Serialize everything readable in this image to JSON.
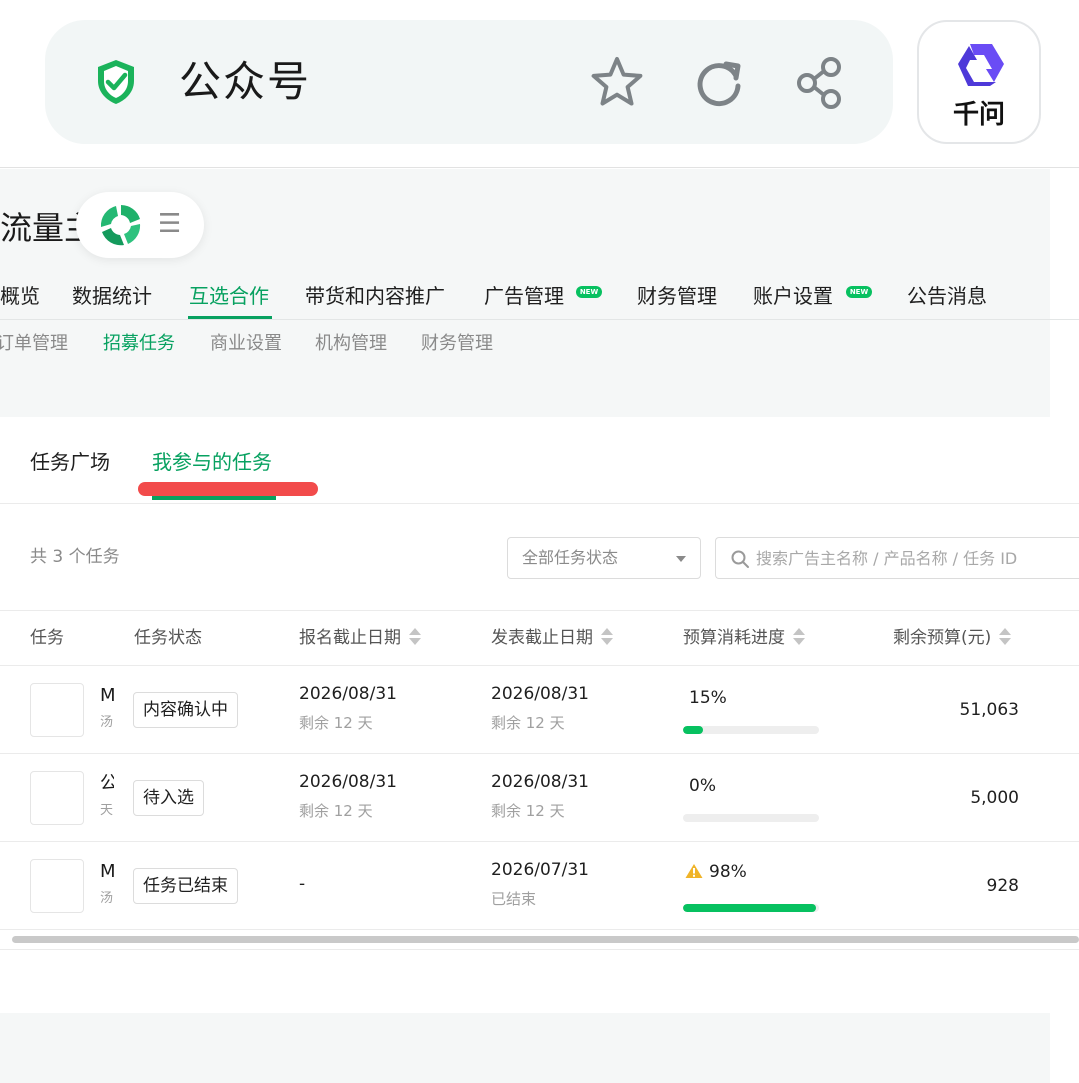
{
  "browser": {
    "site_title": "公众号",
    "icons": [
      "shield-check-icon",
      "star-icon",
      "reload-icon",
      "share-icon"
    ],
    "assistant": {
      "label": "千问",
      "icon": "qwen-logo-icon"
    }
  },
  "account": {
    "name": "流量主",
    "pill_icons": [
      "wechat-channels-logo-icon",
      "menu-icon"
    ]
  },
  "main_nav": {
    "items": [
      {
        "label": "概览"
      },
      {
        "label": "数据统计"
      },
      {
        "label": "互选合作",
        "active": true
      },
      {
        "label": "带货和内容推广"
      },
      {
        "label": "广告管理",
        "badge": "NEW"
      },
      {
        "label": "财务管理"
      },
      {
        "label": "账户设置",
        "badge": "NEW"
      },
      {
        "label": "公告消息"
      }
    ]
  },
  "sub_nav": {
    "items": [
      {
        "label": "订单管理"
      },
      {
        "label": "招募任务",
        "active": true
      },
      {
        "label": "商业设置"
      },
      {
        "label": "机构管理"
      },
      {
        "label": "财务管理"
      }
    ]
  },
  "tabs": [
    {
      "label": "任务广场"
    },
    {
      "label": "我参与的任务",
      "active": true
    }
  ],
  "toolbar": {
    "count_text": "共 3 个任务",
    "status_filter": "全部任务状态",
    "search_placeholder": "搜索广告主名称 / 产品名称 / 任务 ID"
  },
  "table": {
    "columns": [
      "任务",
      "任务状态",
      "报名截止日期",
      "发表截止日期",
      "预算消耗进度",
      "剩余预算(元)"
    ],
    "rows": [
      {
        "name": "M",
        "sub": "汤",
        "status": "内容确认中",
        "signup_deadline": "2026/08/31",
        "signup_remain": "剩余 12 天",
        "publish_deadline": "2026/08/31",
        "publish_remain": "剩余 12 天",
        "progress_text": "15%",
        "progress": 15,
        "warning": false,
        "budget": "51,063"
      },
      {
        "name": "公",
        "sub": "天",
        "status": "待入选",
        "signup_deadline": "2026/08/31",
        "signup_remain": "剩余 12 天",
        "publish_deadline": "2026/08/31",
        "publish_remain": "剩余 12 天",
        "progress_text": "0%",
        "progress": 0,
        "warning": false,
        "budget": "5,000"
      },
      {
        "name": "M",
        "sub": "汤",
        "status": "任务已结束",
        "signup_deadline": "-",
        "signup_remain": "",
        "publish_deadline": "2026/07/31",
        "publish_remain": "已结束",
        "progress_text": "98%",
        "progress": 98,
        "warning": true,
        "budget": "928"
      }
    ]
  },
  "colors": {
    "accent": "#07a160",
    "progress_fill": "#07c160",
    "highlight_mark": "#f24b4b",
    "warning": "#f0b429"
  }
}
